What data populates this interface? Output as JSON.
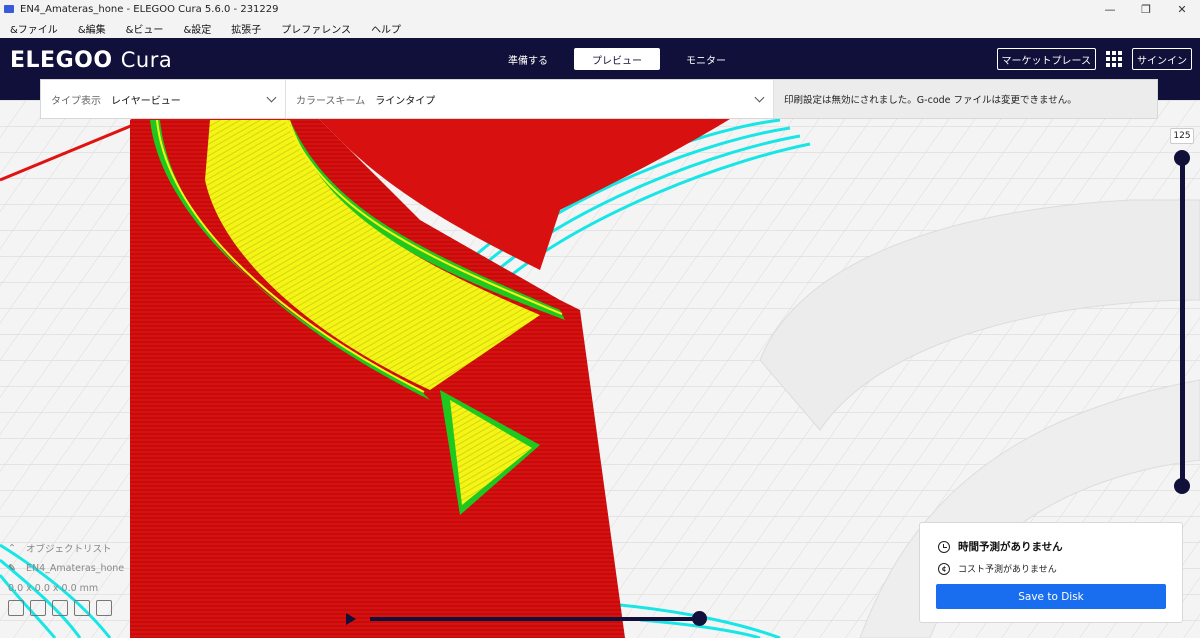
{
  "window": {
    "title": "EN4_Amateras_hone - ELEGOO Cura 5.6.0 - 231229",
    "minimize": "—",
    "restore": "❐",
    "close": "✕"
  },
  "menu": [
    "&ファイル",
    "&編集",
    "&ビュー",
    "&設定",
    "拡張子",
    "プレファレンス",
    "ヘルプ"
  ],
  "header": {
    "logo_brand": "ELEGOO",
    "logo_product": "Cura",
    "tabs": [
      {
        "label": "準備する"
      },
      {
        "label": "プレビュー"
      },
      {
        "label": "モニター"
      }
    ],
    "marketplace": "マーケットプレース",
    "signin": "サインイン"
  },
  "toolbar": {
    "view_type_label": "タイプ表示",
    "view_type_value": "レイヤービュー",
    "color_scheme_label": "カラースキーム",
    "color_scheme_value": "ラインタイプ",
    "notice": "印刷設定は無効にされました。G-code ファイルは変更できません。"
  },
  "layer_slider": {
    "current_layer": "125",
    "position_fraction": 1.0
  },
  "object_panel": {
    "object_list_label": "オブジェクトリスト",
    "file_name": "EN4_Amateras_hone",
    "dimensions": "0.0 x 0.0 x 0.0 mm"
  },
  "print_panel": {
    "time_estimate": "時間予測がありません",
    "cost_estimate": "コスト予測がありません",
    "save_button": "Save to Disk"
  },
  "colors": {
    "header_bg": "#10103a",
    "wall_outer": "#e01212",
    "wall_inner": "#1ec81e",
    "infill": "#f5f515",
    "skirt": "#18e6e6",
    "save_button": "#196ef0"
  }
}
